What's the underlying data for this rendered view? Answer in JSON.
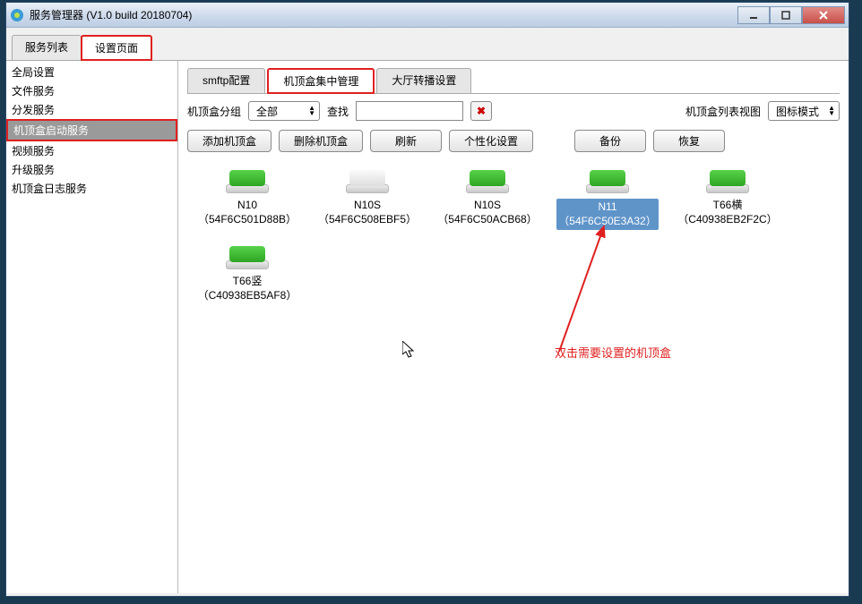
{
  "window": {
    "title": "服务管理器 (V1.0 build 20180704)"
  },
  "topTabs": [
    {
      "label": "服务列表"
    },
    {
      "label": "设置页面"
    }
  ],
  "sidebar": {
    "items": [
      {
        "label": "全局设置"
      },
      {
        "label": "文件服务"
      },
      {
        "label": "分发服务"
      },
      {
        "label": "机顶盒启动服务"
      },
      {
        "label": "视频服务"
      },
      {
        "label": "升级服务"
      },
      {
        "label": "机顶盒日志服务"
      }
    ]
  },
  "subTabs": [
    {
      "label": "smftp配置"
    },
    {
      "label": "机顶盒集中管理"
    },
    {
      "label": "大厅转播设置"
    }
  ],
  "filterRow": {
    "groupLabel": "机顶盒分组",
    "groupValue": "全部",
    "searchLabel": "查找",
    "searchValue": "",
    "viewLabel": "机顶盒列表视图",
    "viewValue": "图标模式"
  },
  "buttons": {
    "add": "添加机顶盒",
    "delete": "删除机顶盒",
    "refresh": "刷新",
    "custom": "个性化设置",
    "backup": "备份",
    "restore": "恢复"
  },
  "boxes": [
    {
      "name": "N10",
      "mac": "（54F6C501D88B）",
      "iconColor": "green",
      "selected": false
    },
    {
      "name": "N10S",
      "mac": "（54F6C508EBF5）",
      "iconColor": "white",
      "selected": false
    },
    {
      "name": "N10S",
      "mac": "（54F6C50ACB68）",
      "iconColor": "green",
      "selected": false
    },
    {
      "name": "N11",
      "mac": "（54F6C50E3A32）",
      "iconColor": "green",
      "selected": true
    },
    {
      "name": "T66横",
      "mac": "（C40938EB2F2C）",
      "iconColor": "green",
      "selected": false
    },
    {
      "name": "T66竖",
      "mac": "（C40938EB5AF8）",
      "iconColor": "green",
      "selected": false
    }
  ],
  "annotation": "双击需要设置的机顶盒"
}
